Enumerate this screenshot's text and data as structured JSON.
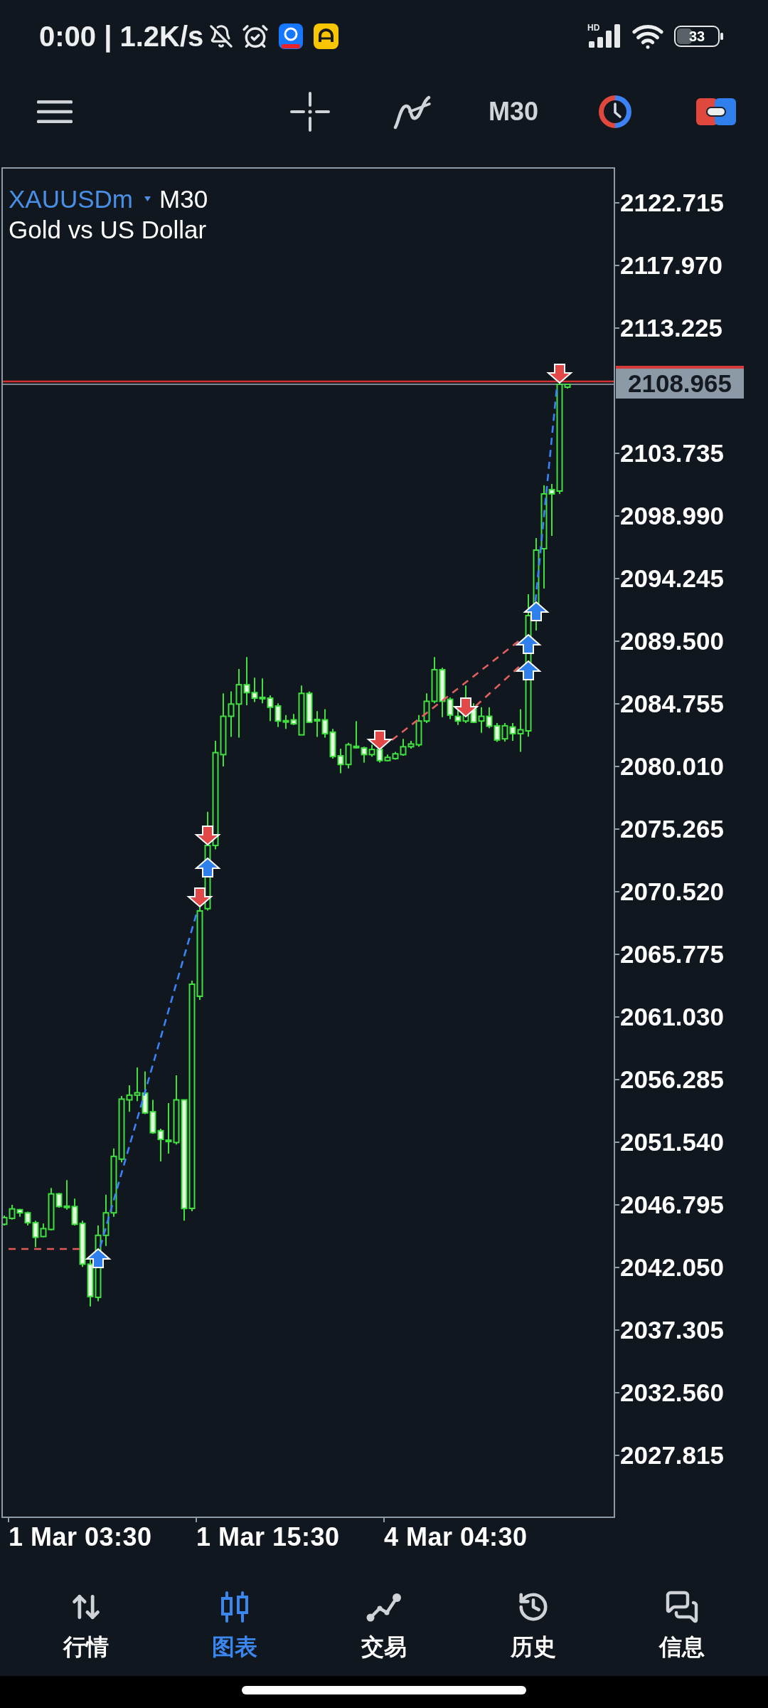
{
  "status_bar": {
    "time": "0:00 | 1.2K/s",
    "network": "HD",
    "battery": "33"
  },
  "toolbar": {
    "timeframe": "M30"
  },
  "chart": {
    "symbol": "XAUUSDm",
    "timeframe": "M30",
    "description": "Gold vs US Dollar",
    "price_axis": {
      "labels_above": [
        "2122.715",
        "2117.970",
        "2113.225"
      ],
      "current_price": "2108.965",
      "labels_below": [
        "2103.735",
        "2098.990",
        "2094.245",
        "2089.500",
        "2084.755",
        "2080.010",
        "2075.265",
        "2070.520",
        "2065.775",
        "2061.030",
        "2056.285",
        "2051.540",
        "2046.795",
        "2042.050",
        "2037.305",
        "2032.560",
        "2027.815"
      ]
    },
    "time_axis": [
      "1 Mar 03:30",
      "1 Mar 15:30",
      "4 Mar 04:30"
    ]
  },
  "bottom_nav": [
    {
      "kind": "quotes",
      "label": "行情",
      "selected": false
    },
    {
      "kind": "chart",
      "label": "图表",
      "selected": true
    },
    {
      "kind": "trade",
      "label": "交易",
      "selected": false
    },
    {
      "kind": "history",
      "label": "历史",
      "selected": false
    },
    {
      "kind": "messages",
      "label": "信息",
      "selected": false
    }
  ]
}
